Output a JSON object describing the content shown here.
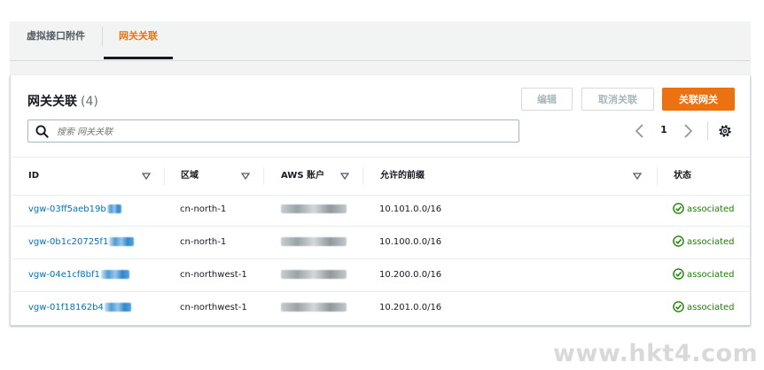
{
  "tabs": [
    {
      "label": "虚拟接口附件",
      "active": false
    },
    {
      "label": "网关关联",
      "active": true
    }
  ],
  "panel": {
    "title": "网关关联",
    "count": "(4)",
    "buttons": {
      "edit": "编辑",
      "disassociate": "取消关联",
      "associate": "关联网关"
    },
    "search_placeholder": "搜索 网关关联",
    "page": "1"
  },
  "table": {
    "columns": [
      "ID",
      "区域",
      "AWS 账户",
      "允许的前缀",
      "状态"
    ],
    "rows": [
      {
        "id": "vgw-03ff5aeb19b",
        "region": "cn-north-1",
        "prefix": "10.101.0.0/16",
        "status": "associated"
      },
      {
        "id": "vgw-0b1c20725f1",
        "region": "cn-north-1",
        "prefix": "10.100.0.0/16",
        "status": "associated"
      },
      {
        "id": "vgw-04e1cf8bf1",
        "region": "cn-northwest-1",
        "prefix": "10.200.0.0/16",
        "status": "associated"
      },
      {
        "id": "vgw-01f18162b4",
        "region": "cn-northwest-1",
        "prefix": "10.201.0.0/16",
        "status": "associated"
      }
    ]
  },
  "icons": {
    "search": "search-icon",
    "prev": "chevron-left-icon",
    "next": "chevron-right-icon",
    "settings": "gear-icon",
    "sort": "sort-down-icon",
    "status": "check-circle-icon"
  },
  "colors": {
    "accent": "#ec7211",
    "link": "#0073bb",
    "success": "#1d8102"
  },
  "watermark": "www.hkt4.com"
}
